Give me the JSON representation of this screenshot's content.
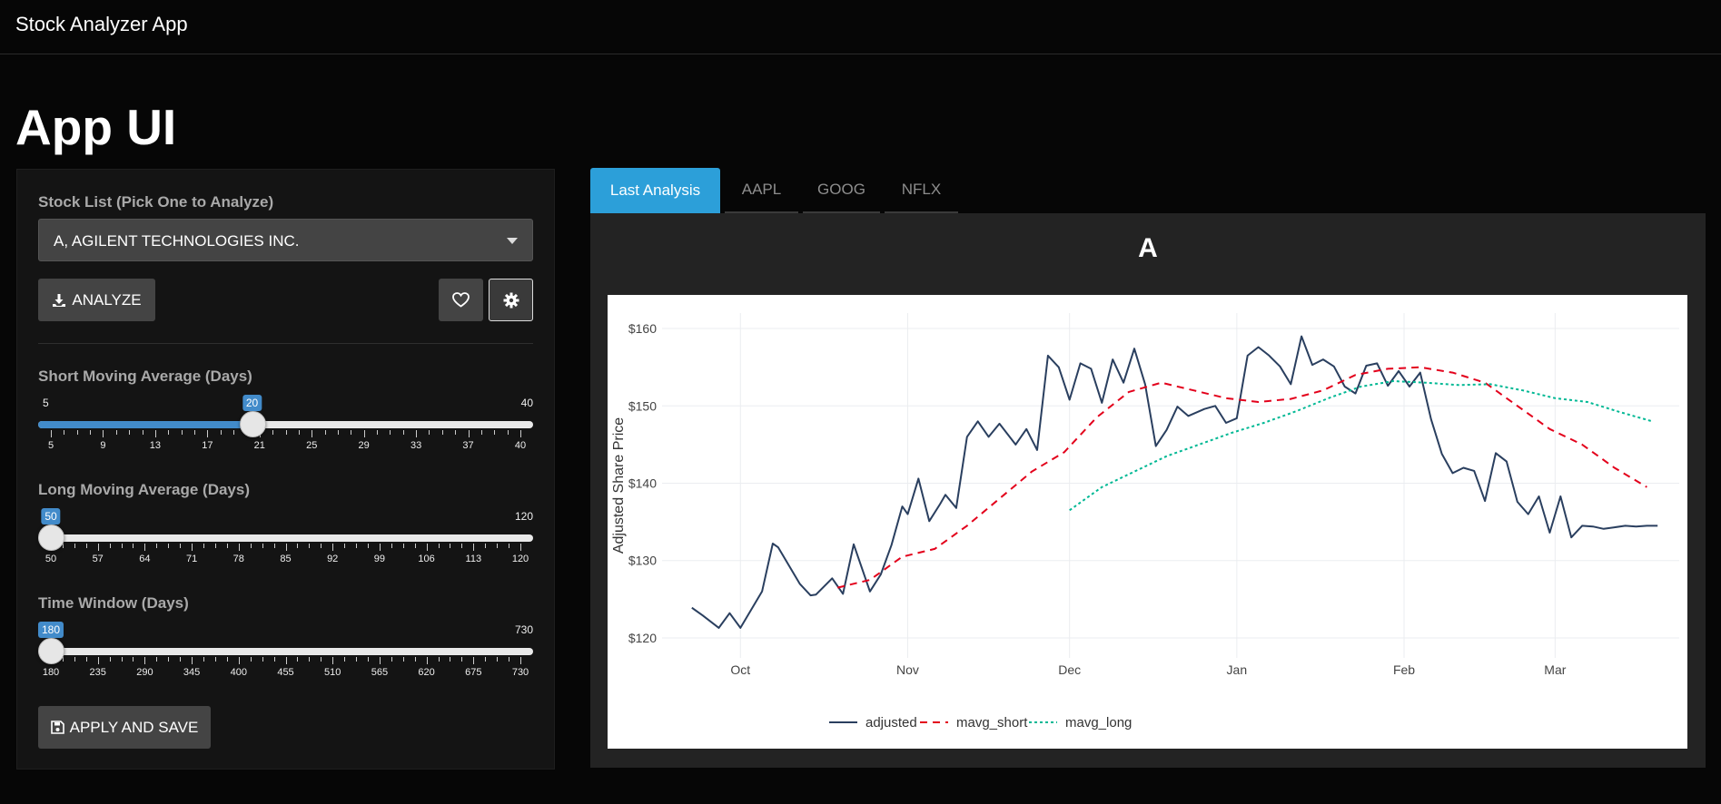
{
  "app": {
    "brand": "Stock Analyzer App",
    "page_title": "App UI"
  },
  "sidebar": {
    "stock_label": "Stock List (Pick One to Analyze)",
    "stock_selected": "A, AGILENT TECHNOLOGIES INC.",
    "analyze_label": "ANALYZE",
    "apply_label": "APPLY AND SAVE",
    "short": {
      "label": "Short Moving Average (Days)",
      "min": 5,
      "max": 40,
      "value": 20,
      "min_text": "5",
      "max_text": "40",
      "value_text": "20",
      "ticks": [
        "5",
        "9",
        "13",
        "17",
        "21",
        "25",
        "29",
        "33",
        "37",
        "40"
      ]
    },
    "long": {
      "label": "Long Moving Average (Days)",
      "min": 50,
      "max": 120,
      "value": 50,
      "min_text": "50",
      "max_text": "120",
      "value_text": "50",
      "ticks": [
        "50",
        "57",
        "64",
        "71",
        "78",
        "85",
        "92",
        "99",
        "106",
        "113",
        "120"
      ]
    },
    "window": {
      "label": "Time Window (Days)",
      "min": 180,
      "max": 730,
      "value": 180,
      "min_text": "180",
      "max_text": "730",
      "value_text": "180",
      "ticks": [
        "180",
        "235",
        "290",
        "345",
        "400",
        "455",
        "510",
        "565",
        "620",
        "675",
        "730"
      ]
    }
  },
  "tabs": [
    "Last Analysis",
    "AAPL",
    "GOOG",
    "NFLX"
  ],
  "colors": {
    "accent": "#2c9fd9",
    "slider": "#428bca",
    "adjusted": "#2a3f5f",
    "mavg_short": "#e3001b",
    "mavg_long": "#00b894"
  },
  "chart_data": {
    "type": "line",
    "title": "A",
    "ylabel": "Adjusted Share Price",
    "xlabel": "",
    "x_ticks": [
      "Oct",
      "Nov",
      "Dec",
      "Jan",
      "Feb",
      "Mar"
    ],
    "y_ticks": [
      "$120",
      "$130",
      "$140",
      "$150",
      "$160"
    ],
    "ylim": [
      118,
      162
    ],
    "grid": true,
    "legend_position": "bottom",
    "series": [
      {
        "name": "adjusted",
        "x": [
          "2021-09-22",
          "2021-09-24",
          "2021-09-27",
          "2021-09-29",
          "2021-10-01",
          "2021-10-05",
          "2021-10-07",
          "2021-10-08",
          "2021-10-12",
          "2021-10-14",
          "2021-10-15",
          "2021-10-18",
          "2021-10-20",
          "2021-10-22",
          "2021-10-25",
          "2021-10-27",
          "2021-10-29",
          "2021-10-31",
          "2021-11-01",
          "2021-11-03",
          "2021-11-05",
          "2021-11-07",
          "2021-11-08",
          "2021-11-10",
          "2021-11-12",
          "2021-11-14",
          "2021-11-16",
          "2021-11-18",
          "2021-11-21",
          "2021-11-23",
          "2021-11-25",
          "2021-11-27",
          "2021-11-29",
          "2021-12-01",
          "2021-12-03",
          "2021-12-05",
          "2021-12-07",
          "2021-12-09",
          "2021-12-11",
          "2021-12-13",
          "2021-12-15",
          "2021-12-17",
          "2021-12-19",
          "2021-12-21",
          "2021-12-23",
          "2021-12-26",
          "2021-12-28",
          "2021-12-30",
          "2022-01-01",
          "2022-01-03",
          "2022-01-05",
          "2022-01-07",
          "2022-01-09",
          "2022-01-11",
          "2022-01-13",
          "2022-01-15",
          "2022-01-17",
          "2022-01-19",
          "2022-01-21",
          "2022-01-23",
          "2022-01-25",
          "2022-01-27",
          "2022-01-29",
          "2022-01-31",
          "2022-02-02",
          "2022-02-04",
          "2022-02-06",
          "2022-02-08",
          "2022-02-10",
          "2022-02-12",
          "2022-02-14",
          "2022-02-16",
          "2022-02-18",
          "2022-02-20",
          "2022-02-22",
          "2022-02-24",
          "2022-02-26",
          "2022-02-28",
          "2022-03-02",
          "2022-03-04",
          "2022-03-06",
          "2022-03-08",
          "2022-03-10",
          "2022-03-12",
          "2022-03-14",
          "2022-03-16",
          "2022-03-18",
          "2022-03-20"
        ],
        "values": [
          123.9,
          122.9,
          121.3,
          123.2,
          121.3,
          126.0,
          132.2,
          131.7,
          127.0,
          125.5,
          125.6,
          127.7,
          125.7,
          132.1,
          126.0,
          128.2,
          132.0,
          137.0,
          136.0,
          140.6,
          135.1,
          137.3,
          138.5,
          136.8,
          146.0,
          148.0,
          146.0,
          147.7,
          145.0,
          147.0,
          144.3,
          156.5,
          155.0,
          150.8,
          155.5,
          154.8,
          150.4,
          156.0,
          153.0,
          157.4,
          152.8,
          144.8,
          146.9,
          149.9,
          148.7,
          149.6,
          150.0,
          147.8,
          148.4,
          156.5,
          157.6,
          156.5,
          155.1,
          152.8,
          159.0,
          155.3,
          156.0,
          155.1,
          152.5,
          151.6,
          155.2,
          155.5,
          152.6,
          154.5,
          152.5,
          154.3,
          148.3,
          143.8,
          141.3,
          142.0,
          141.6,
          137.7,
          143.9,
          142.8,
          137.6,
          136.0,
          138.3,
          133.6,
          138.3,
          133.0,
          134.5,
          134.4,
          134.1,
          134.3,
          134.5,
          134.4,
          134.5,
          134.5
        ]
      },
      {
        "name": "mavg_short",
        "x": [
          "2021-10-19",
          "2021-10-25",
          "2021-10-31",
          "2021-11-06",
          "2021-11-12",
          "2021-11-18",
          "2021-11-24",
          "2021-11-30",
          "2021-12-06",
          "2021-12-12",
          "2021-12-18",
          "2021-12-24",
          "2021-12-30",
          "2022-01-05",
          "2022-01-11",
          "2022-01-17",
          "2022-01-23",
          "2022-01-29",
          "2022-02-04",
          "2022-02-10",
          "2022-02-16",
          "2022-02-22",
          "2022-02-28",
          "2022-03-06",
          "2022-03-12",
          "2022-03-18"
        ],
        "values": [
          126.5,
          127.5,
          130.5,
          131.5,
          134.5,
          138.0,
          141.5,
          144.0,
          148.5,
          151.8,
          153.0,
          152.0,
          151.0,
          150.5,
          150.9,
          152.0,
          154.0,
          154.8,
          155.0,
          154.3,
          153.0,
          150.0,
          147.0,
          145.0,
          142.0,
          139.5
        ]
      },
      {
        "name": "mavg_long",
        "x": [
          "2021-12-01",
          "2021-12-07",
          "2021-12-13",
          "2021-12-19",
          "2021-12-25",
          "2021-12-31",
          "2022-01-06",
          "2022-01-12",
          "2022-01-18",
          "2022-01-24",
          "2022-01-30",
          "2022-02-05",
          "2022-02-11",
          "2022-02-17",
          "2022-02-23",
          "2022-03-01",
          "2022-03-07",
          "2022-03-13",
          "2022-03-19"
        ],
        "values": [
          136.5,
          139.5,
          141.5,
          143.5,
          145.0,
          146.5,
          147.8,
          149.3,
          151.0,
          152.5,
          153.2,
          153.0,
          152.7,
          152.8,
          152.0,
          151.0,
          150.5,
          149.2,
          148.0
        ]
      }
    ]
  }
}
